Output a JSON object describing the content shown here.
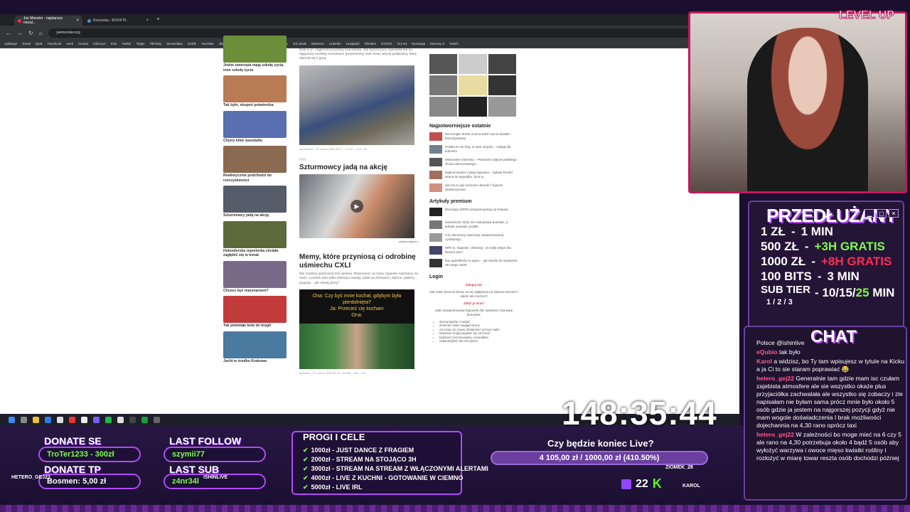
{
  "browser": {
    "tabs": [
      {
        "label": "Joe Monster - najstarsza niezal...",
        "active": true
      },
      {
        "label": "Rozrywka - BOOP.PL",
        "active": false
      }
    ],
    "url": "joemonster.org",
    "bookmarks": [
      "Aplikacje",
      "Gmail",
      "Dysk",
      "Facebook",
      "work",
      "Oculus",
      "IshinLive",
      "Kick",
      "Twitter",
      "Tipply",
      "TikFinity",
      "Streamlabs",
      "Grafik",
      "YouTube",
      "JBZD.pl",
      "JoeMonster",
      "Games",
      "Łowcy Gier",
      "GG.deals",
      "Behance",
      "LinkedIn",
      "Unsplash",
      "Shinden",
      "STOCK",
      "Gry tnt",
      "Norwegia",
      "Memory 5",
      "Twitch"
    ]
  },
  "page": {
    "left_thumbs": [
      {
        "caption": "Jedne zwierzęta mają szkołę życia, inne szkołę życia",
        "color": "#6b8e3a"
      },
      {
        "caption": "Tak było, ekspert potwierdza",
        "color": "#b87b55"
      },
      {
        "caption": "Chytry kibic baseballu",
        "color": "#5a6fb0"
      },
      {
        "caption": "Realistycznie podchodzi do rzeczywistości",
        "color": "#8a6a50"
      },
      {
        "caption": "Szturmowcy jadą na akcję",
        "color": "#555c6a"
      },
      {
        "caption": "Holenderska reporterka chciała zagłębić się w temat",
        "color": "#5c6a3c"
      },
      {
        "caption": "Chcesz być marynarzem?",
        "color": "#7a6a8a"
      },
      {
        "caption": "Tak powstaje kula do kręgli",
        "color": "#c23b3b"
      },
      {
        "caption": "Jacht w środku Krakowa",
        "color": "#4a7aa0"
      }
    ],
    "intro_text": "Dziś m.in. najprzeźroczystszy kraj świata. Jak Dutchczycy szykowali się na najgorszy możliwy scenariusz (powinniśmy mieć teraz więcej podwodny, który zderzył się z górą.",
    "meta1": "leonmorlini · 23 marca 2026 08:17 · 24 337 · 233 · 98",
    "art2_cat": "Film",
    "art2_title": "Szturmowcy jadą na akcję",
    "art2_more": "zobacz więcej »",
    "art3_title": "Memy, które przyniosą ci odrobinę uśmiechu CXLI",
    "art3_intro": "Nie rzadziej astronomiczna wiosna. Równomoc za nami, topienie marzanny za nami, a przed nami tylko kwitnące kwiaty, ptaki na drzewach, słońce i piękna pogoda... ale chwiej jemy?",
    "meme_text": "Ona: Czy byś mnie kochał, gdybym była pierdolnięta?\nJa: Przecież cię kocham\nOna:",
    "meta3": "bebenko · 23 marca 2026 06:12 · 26 608 · 298 · 102",
    "right": {
      "popular_title": "Najpotworniejsze ostatnie",
      "popular": [
        "Na Google Street można trafić nocne kwiatki – Demotywatory",
        "Polska to nie kraj, to stan umysłu – Usługi dla ludności",
        "Mistrzowie internetu – Pierwsze zdjęcie polskiego drona uderzonowego...",
        "Najmocniejsze cytaty tygodnia – Sylwia Peretti wraca do wypadku: tyna w...",
        "Nie ma to jak ruchome obrazki z fajnymi dziewczynami"
      ],
      "premium_title": "Artykuły premium",
      "premium": [
        "Dlaczego ZSRR przegrał wyścig na Księżyc",
        "Samochód, który nie miał prawa powstać, a jednak powstał i podbił...",
        "Czy dinozaury stworzyły zaawansowaną cywilizację...",
        "MP3 in, Napster i Winamp: „It really whips the llama's ass!\"",
        "Ilan ajatollahów w ogniu – jak doszło do wydarzeń 28 lutego 2026"
      ],
      "login_title": "Login",
      "login_lines": [
        "Zaloguj się!",
        "Nie masz jeszcze konta na tej najlepszej na świecie stronie?! Jakże tak można?!",
        "Załóż je teraz!",
        "Jako zarejestrowany bojownik JM, będziesz miał parę bonusów:"
      ],
      "login_bullets": [
        "strona będzie ci widać",
        "zmienisz sobie wygląd strony",
        "od czasu do czasu dostaniesz od nas maile",
        "będziesz mógł pogadać się na forum",
        "będziesz rozczarowany i oceniałem",
        "ulubione(fav) nas szczęście"
      ]
    }
  },
  "overlay": {
    "rates_title": "PRZEDŁUŻANY",
    "rates": [
      {
        "price": "1 ZŁ",
        "value": "1 MIN",
        "extra": ""
      },
      {
        "price": "500 ZŁ",
        "value": "+3H GRATIS",
        "extra": "green"
      },
      {
        "price": "1000 ZŁ",
        "value": "+8H GRATIS",
        "extra": "red"
      },
      {
        "price": "100 BITS",
        "value": "3 MIN",
        "extra": ""
      }
    ],
    "subtier_label": "SUB TIER",
    "subtier_nums": "1 / 2 / 3",
    "subtier_value_a": "10/15/",
    "subtier_value_b": "25",
    "subtier_value_c": " MIN",
    "chat_title": "CHAT",
    "chat": [
      {
        "user": "",
        "text": "Polsce @ishinlive"
      },
      {
        "user": "eQubio",
        "text": "tak było"
      },
      {
        "user": "Karol",
        "text": "a widzisz, bo Ty tam wpisujesz w tytule na Kicku a ja Ci to sie staram poprawiać 😂"
      },
      {
        "user": "hetero_gej22",
        "text": "Generalnie tam gdzie mam isc czułam zajebista atmosfere ale sie wszystko okaże plus przyjaciółka zachwalała ale wszystko się zobaczy i zle napisałam nie byłam sama prócz mnie było około 5 osób gdzie ja jestem na najgorszej pozycji gdyż nie mam wogole doświadczenia I brak możliwości dojechannia na 4,30 rano oprócz taxi"
      },
      {
        "user": "hetero_gej22",
        "text": "W zależności bo moge mieć na 6 czy 5 ale rano na 4,30 potrzebuja około 4 bądź 5 osób aby wyłożyć warzywa i owoce mięso kwiatki rośliny i rozłożyć w miarę towar reszta osób dochodzi później"
      }
    ],
    "timer": "148:35:44",
    "donate_se_label": "DONATE SE",
    "donate_se_value": "TroTer1233 - 300zł",
    "donate_tp_label": "DONATE TP",
    "donate_tp_value": "Bosmen: 5,00 zł",
    "last_follow_label": "LAST FOLLOW",
    "last_follow_value": "szymii77",
    "last_sub_label": "LAST SUB",
    "last_sub_value": "z4nr34l",
    "goals_title": "PROGI I CELE",
    "goals": [
      "1000zł - JUST DANCE Z FRAGIEM",
      "2000zł - STREAM NA STOJĄCO 3H",
      "3000zł - STREAM NA STREAM Z WŁĄCZONYMI ALERTAMI",
      "4000zł - LIVE Z KUCHNI - GOTOWANIE W CIEMNO",
      "5000zł - LIVE IRL"
    ],
    "live_question": "Czy będzie koniec Live?",
    "live_progress": "4 105,00 zł / 1000,00 zł (410.50%)",
    "viewers": "22",
    "usernames": [
      "HETERO_GEJ22",
      "ISHINLIVE",
      "ZIOMEK_28",
      "KAROL"
    ],
    "colors": {
      "accent": "#b24bf3",
      "green": "#7dfc4a",
      "red": "#ff2d55",
      "panel": "#241436"
    }
  }
}
